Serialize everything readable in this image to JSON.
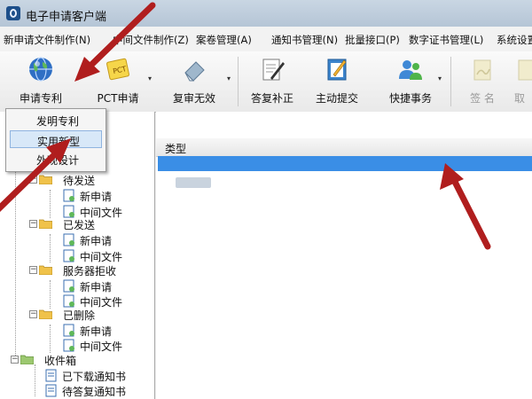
{
  "window": {
    "title": "电子申请客户端"
  },
  "menu": [
    "新申请文件制作(N)",
    "中间文件制作(Z)",
    "案卷管理(A)",
    "通知书管理(N)",
    "批量接口(P)",
    "数字证书管理(L)",
    "系统设置"
  ],
  "toolbar": {
    "buttons": [
      {
        "label": "申请专利",
        "icon": "globe-icon"
      },
      {
        "label": "PCT申请",
        "icon": "pct-document-icon"
      },
      {
        "label": "复审无效",
        "icon": "eraser-icon"
      },
      {
        "label": "答复补正",
        "icon": "pen-paper-icon"
      },
      {
        "label": "主动提交",
        "icon": "edit-document-icon"
      },
      {
        "label": "快捷事务",
        "icon": "users-icon"
      },
      {
        "label": "签 名",
        "icon": "sign-icon"
      },
      {
        "label": "取",
        "icon": "cancel-icon"
      }
    ]
  },
  "dropdown": {
    "items": [
      "发明专利",
      "实用新型",
      "外观设计"
    ],
    "highlighted": 1
  },
  "tree": {
    "pending": "待发送",
    "sent": "已发送",
    "rejected": "服务器拒收",
    "deleted": "已删除",
    "new_app": "新申请",
    "interim": "中间文件",
    "inbox": "收件箱",
    "downloaded": "已下载通知书",
    "to_reply": "待答复通知书"
  },
  "list": {
    "column_type": "类型"
  },
  "colors": {
    "selection": "#3a8ee6",
    "annotation": "#b01e1e"
  }
}
